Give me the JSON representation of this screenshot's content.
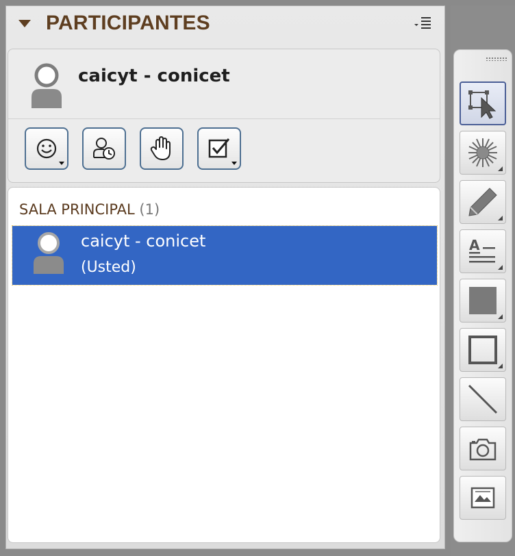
{
  "panel": {
    "title": "PARTICIPANTES",
    "collapse_icon": "triangle-down-icon",
    "menu_icon": "list-menu-icon"
  },
  "current_user": {
    "name": "caicyt - conicet",
    "avatar_icon": "user-silhouette-icon"
  },
  "user_tools": [
    {
      "name": "status-button",
      "icon": "smiley-icon",
      "has_dropdown": true
    },
    {
      "name": "step-away-button",
      "icon": "user-clock-icon",
      "has_dropdown": false
    },
    {
      "name": "raise-hand-button",
      "icon": "hand-icon",
      "has_dropdown": false
    },
    {
      "name": "agree-button",
      "icon": "checkbox-icon",
      "has_dropdown": true
    }
  ],
  "room": {
    "label": "SALA PRINCIPAL",
    "count": "(1)",
    "participants": [
      {
        "name": "caicyt - conicet",
        "subtitle": "(Usted)",
        "selected": true
      }
    ]
  },
  "whiteboard_tools": [
    {
      "name": "selection-tool",
      "icon": "select-arrow-icon",
      "active": true
    },
    {
      "name": "highlight-tool",
      "icon": "starburst-icon",
      "active": false
    },
    {
      "name": "pencil-tool",
      "icon": "pencil-icon",
      "active": false
    },
    {
      "name": "text-tool",
      "icon": "text-lines-icon",
      "active": false
    },
    {
      "name": "filled-shape-tool",
      "icon": "filled-square-icon",
      "active": false
    },
    {
      "name": "shape-outline-tool",
      "icon": "square-outline-icon",
      "active": false
    },
    {
      "name": "line-tool",
      "icon": "diagonal-line-icon",
      "active": false
    },
    {
      "name": "snapshot-tool",
      "icon": "camera-icon",
      "active": false
    },
    {
      "name": "image-tool",
      "icon": "picture-icon",
      "active": false
    }
  ],
  "colors": {
    "title_brown": "#5e3e20",
    "selection_blue": "#3366c4",
    "button_border": "#4d6f91"
  }
}
